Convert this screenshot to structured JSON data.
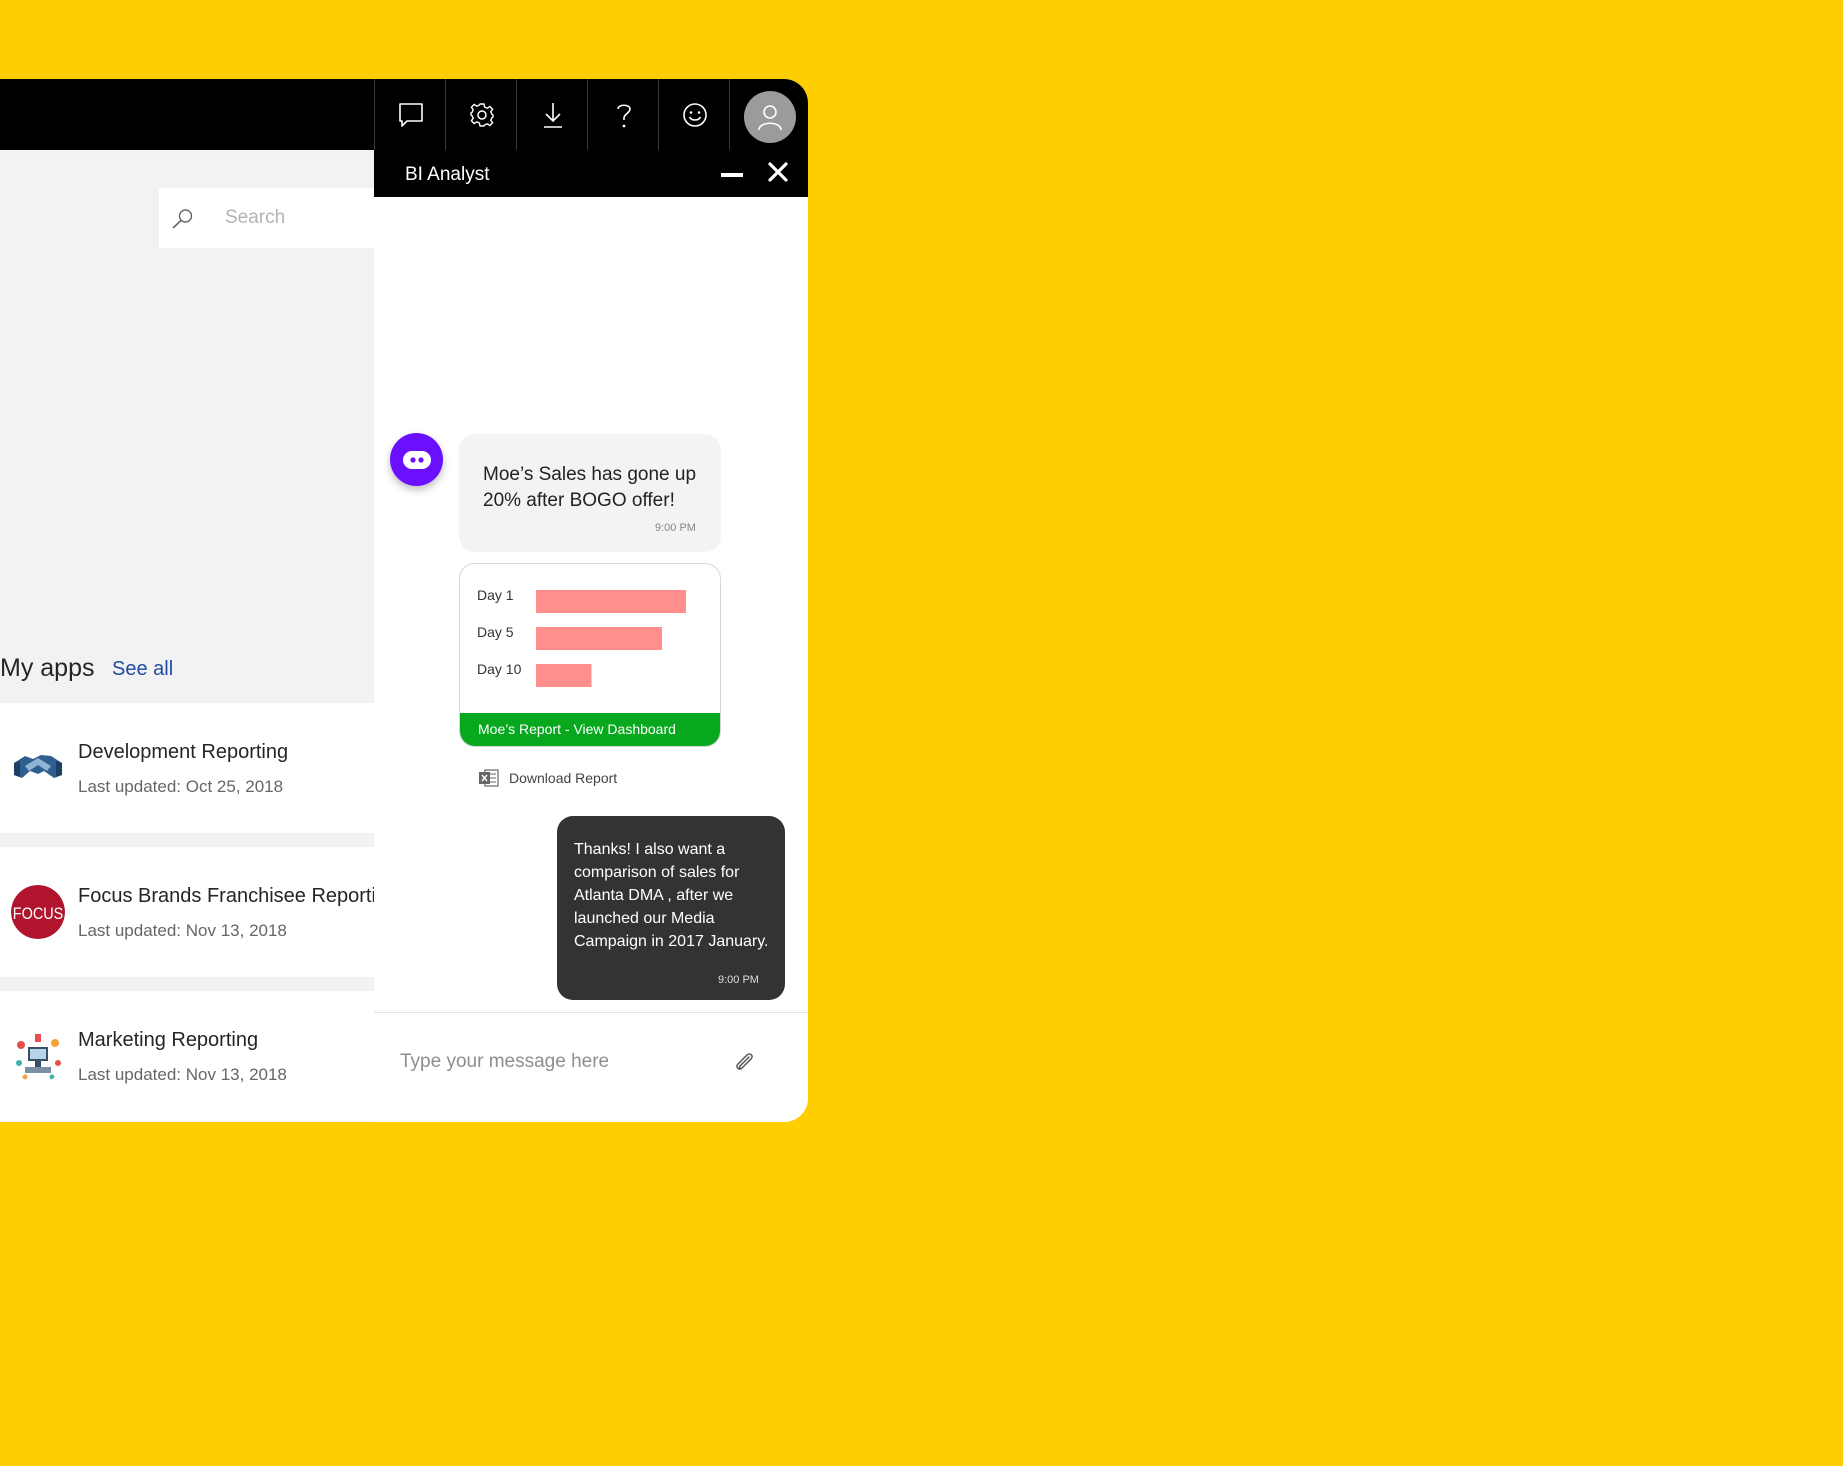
{
  "topbar": {
    "icons": [
      "chat-icon",
      "gear-icon",
      "download-icon",
      "help-icon",
      "smiley-icon"
    ],
    "avatar_icon": "user-avatar-icon"
  },
  "search": {
    "placeholder": "Search",
    "value": ""
  },
  "apps": {
    "heading": "My apps",
    "see_all": "See all",
    "items": [
      {
        "title": "Development Reporting",
        "updated": "Last updated: Oct 25, 2018",
        "icon": "handshake-icon"
      },
      {
        "title": "Focus Brands Franchisee Reporting",
        "updated": "Last updated: Nov 13, 2018",
        "icon": "focus-logo",
        "logo_text": "FOCUS"
      },
      {
        "title": "Marketing Reporting",
        "updated": "Last updated: Nov 13, 2018",
        "icon": "marketing-icon"
      }
    ]
  },
  "chat": {
    "title": "BI Analyst",
    "bot_message": {
      "text": "Moe’s Sales has gone up 20% after BOGO offer!",
      "time": "9:00 PM"
    },
    "report_card": {
      "link_label": "Moe’s Report - View Dashboard",
      "bar_color": "#ff8e8c",
      "link_color": "#07a81e"
    },
    "download_label": "Download Report",
    "user_message": {
      "text": "Thanks! I also want a comparison of sales for Atlanta DMA , after we launched our Media Campaign in 2017 January.",
      "time": "9:00 PM"
    },
    "input_placeholder": "Type your message here",
    "input_value": ""
  },
  "chart_data": {
    "type": "bar",
    "orientation": "horizontal",
    "categories": [
      "Day 1",
      "Day 5",
      "Day 10"
    ],
    "values": [
      100,
      84,
      37
    ],
    "color": "#ff8e8c"
  },
  "colors": {
    "background": "#FFCE00",
    "bot_accent": "#6a10ff",
    "link": "#1f4ba5"
  }
}
